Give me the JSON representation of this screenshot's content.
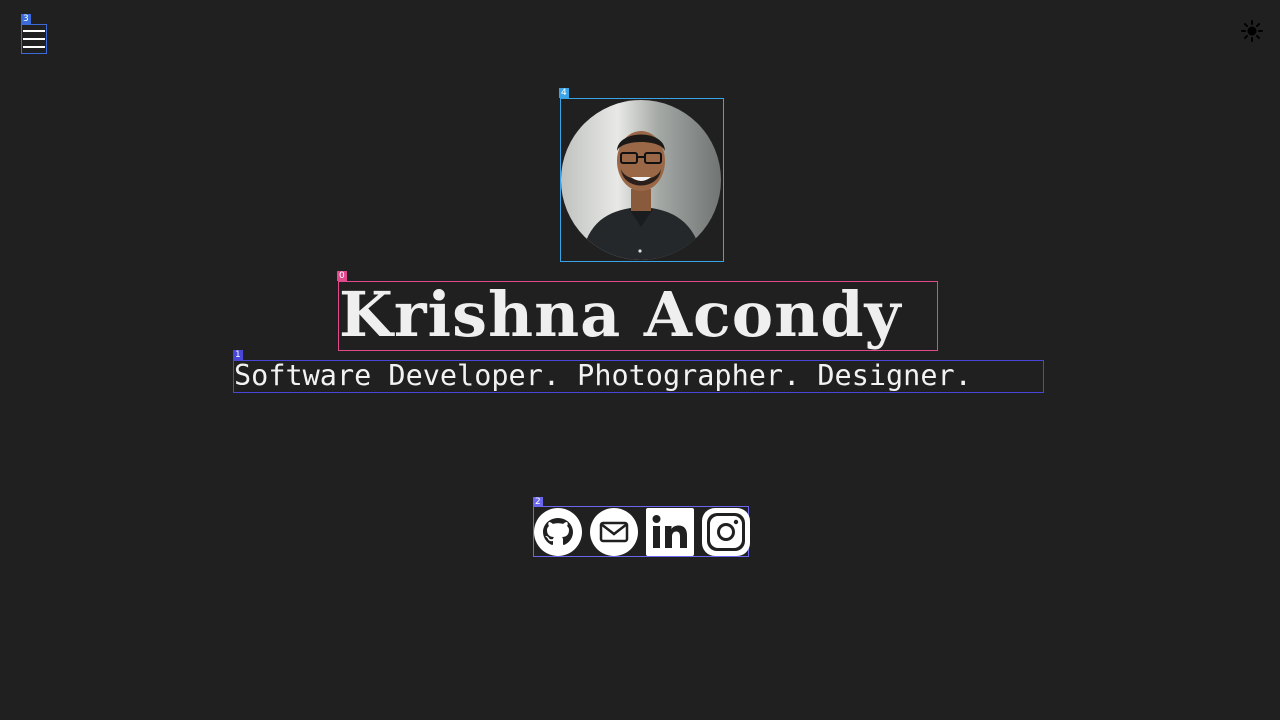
{
  "header": {
    "menu_icon": "hamburger-menu-icon",
    "theme_icon": "sun-icon"
  },
  "profile": {
    "name": "Krishna Acondy",
    "tagline": "Software Developer. Photographer. Designer."
  },
  "socials": [
    {
      "icon": "github-icon"
    },
    {
      "icon": "email-icon"
    },
    {
      "icon": "linkedin-icon"
    },
    {
      "icon": "instagram-icon"
    }
  ],
  "annotations": {
    "badge_0": "0",
    "badge_1": "1",
    "badge_2": "2",
    "badge_3": "3",
    "badge_4": "4"
  },
  "colors": {
    "background": "#202020",
    "text": "#efefef",
    "badge_menu": "#3a6bd8",
    "badge_avatar": "#3aa3e8",
    "badge_name": "#e04a8c",
    "badge_tagline": "#4a46d8",
    "badge_socials": "#6a67ec"
  }
}
